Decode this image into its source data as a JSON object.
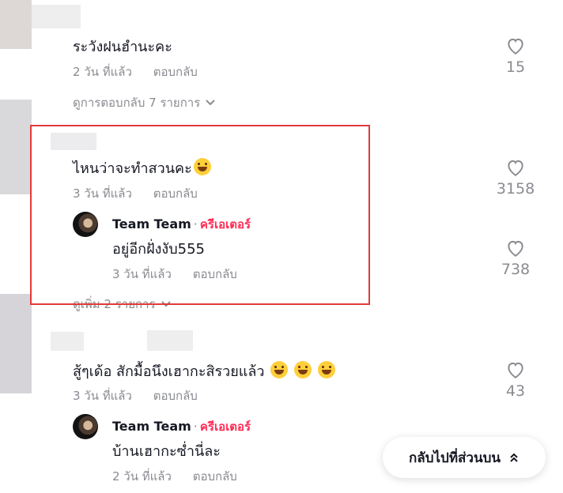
{
  "comments": [
    {
      "text": "ระวังฝนฮำนะคะ",
      "time": "2 วัน ที่แล้ว",
      "reply_label": "ตอบกลับ",
      "likes": "15",
      "view_replies": "ดูการตอบกลับ 7 รายการ"
    },
    {
      "text": "ไหนว่าจะทำสวนคะ",
      "time": "3 วัน ที่แล้ว",
      "reply_label": "ตอบกลับ",
      "likes": "3158",
      "reply": {
        "author": "Team Team",
        "separator": "·",
        "badge": "ครีเอเตอร์",
        "text": "อยู่อีกฝั่งงับ555",
        "time": "3 วัน ที่แล้ว",
        "reply_label": "ตอบกลับ",
        "likes": "738"
      },
      "view_more": "ดูเพิ่ม 2 รายการ"
    },
    {
      "text": "สู้ๆเด้อ สักมื้อนึงเฮากะสิรวยแล้ว",
      "time": "3 วัน ที่แล้ว",
      "reply_label": "ตอบกลับ",
      "likes": "43",
      "reply": {
        "author": "Team Team",
        "separator": "·",
        "badge": "ครีเอเตอร์",
        "text": "บ้านเฮากะซ่ำนี่ละ",
        "time": "2 วัน ที่แล้ว",
        "reply_label": "ตอบกลับ"
      }
    }
  ],
  "back_to_top": "กลับไปที่ส่วนบน",
  "icons": {
    "like": "heart-outline-icon",
    "chevron": "chevron-down-icon",
    "back_top": "double-chevron-up-icon",
    "emoji": "grinning-sweat-emoji"
  },
  "colors": {
    "creator_badge": "#fe2c55",
    "highlight_box": "#e03a3a",
    "muted_text": "#8a8b91"
  }
}
